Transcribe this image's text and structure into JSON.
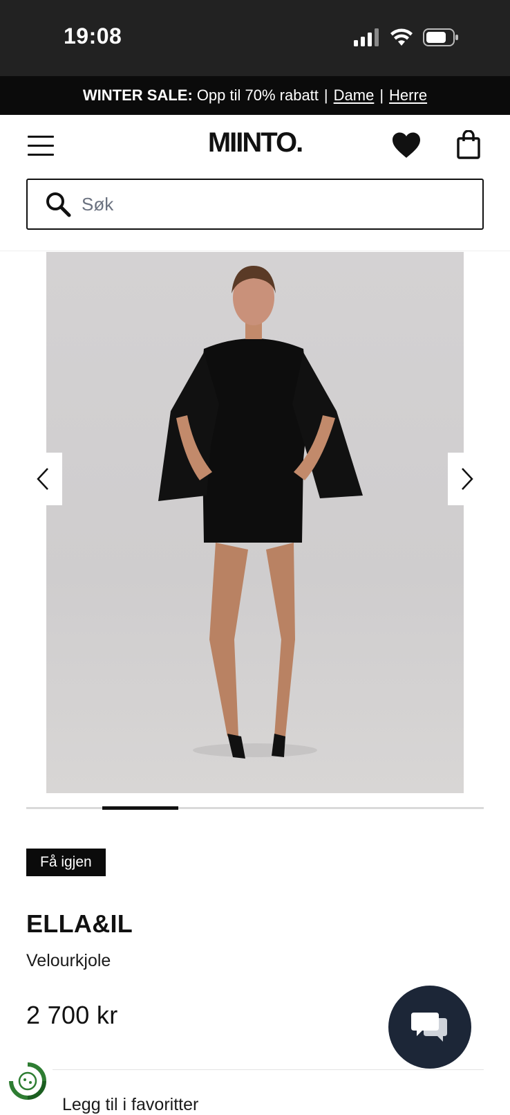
{
  "status_bar": {
    "time": "19:08",
    "icons": [
      "signal-icon",
      "wifi-icon",
      "battery-icon"
    ]
  },
  "sale_banner": {
    "title": "WINTER SALE:",
    "text": "Opp til 70% rabatt",
    "separator": "|",
    "link_women": "Dame",
    "link_men": "Herre"
  },
  "header": {
    "logo": "MIINTO.",
    "icons": [
      "menu-icon",
      "heart-icon",
      "shopping-bag-icon"
    ]
  },
  "search": {
    "placeholder": "Søk",
    "value": ""
  },
  "gallery": {
    "image_alt": "Veloukjole",
    "current_index_fraction": 0.25
  },
  "product": {
    "badge": "Få igjen",
    "brand": "ELLA&IL",
    "name": "Velourkjole",
    "price": "2 700 kr",
    "add_to_favorites": "Legg til i favoritter"
  },
  "colors": {
    "status_bg": "#222222",
    "banner_bg": "#0b0b0b",
    "chat_bg": "#1c2637",
    "eco_green": "#2e7d32"
  }
}
